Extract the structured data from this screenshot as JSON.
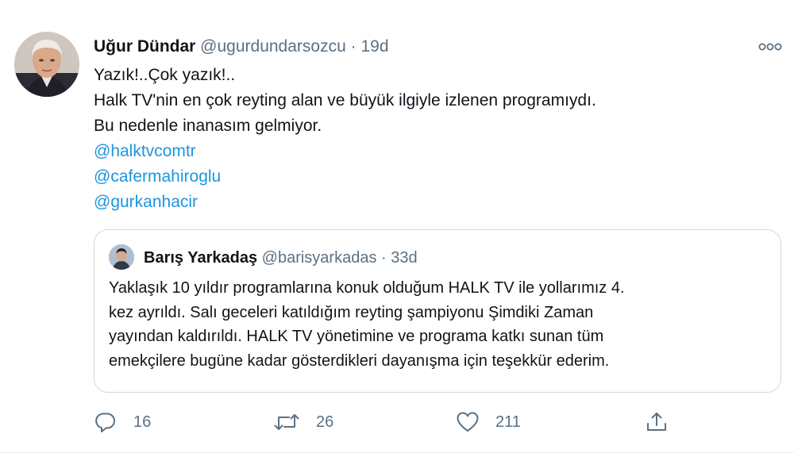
{
  "tweet": {
    "author_name": "Uğur Dündar",
    "handle": "@ugurdundarsozcu",
    "separator": "·",
    "time": "19d",
    "lines": [
      "Yazık!..Çok yazık!..",
      "Halk TV'nin en çok reyting alan ve büyük ilgiyle izlenen programıydı.",
      "Bu nedenle inanasım gelmiyor."
    ],
    "mentions": [
      "@halktvcomtr",
      "@cafermahiroglu",
      "@gurkanhacir"
    ]
  },
  "quoted_tweet": {
    "author_name": "Barış Yarkadaş",
    "handle": "@barisyarkadas",
    "separator": "·",
    "time": "33d",
    "lines": [
      "Yaklaşık 10 yıldır programlarına konuk olduğum HALK TV ile yollarımız 4.",
      "kez ayrıldı. Salı geceleri katıldığım reyting şampiyonu Şimdiki Zaman",
      "yayından kaldırıldı. HALK TV yönetimine ve programa katkı sunan tüm",
      "emekçilere bugüne kadar gösterdikleri dayanışma için teşekkür ederim."
    ]
  },
  "actions": {
    "reply": {
      "icon": "reply-icon",
      "count": "16"
    },
    "retweet": {
      "icon": "retweet-icon",
      "count": "26"
    },
    "like": {
      "icon": "heart-icon",
      "count": "211"
    },
    "share": {
      "icon": "share-icon"
    }
  },
  "colors": {
    "link": "#1b95e0",
    "secondary_text": "#5b7083",
    "border": "#cfd9de",
    "text": "#0f1419"
  }
}
